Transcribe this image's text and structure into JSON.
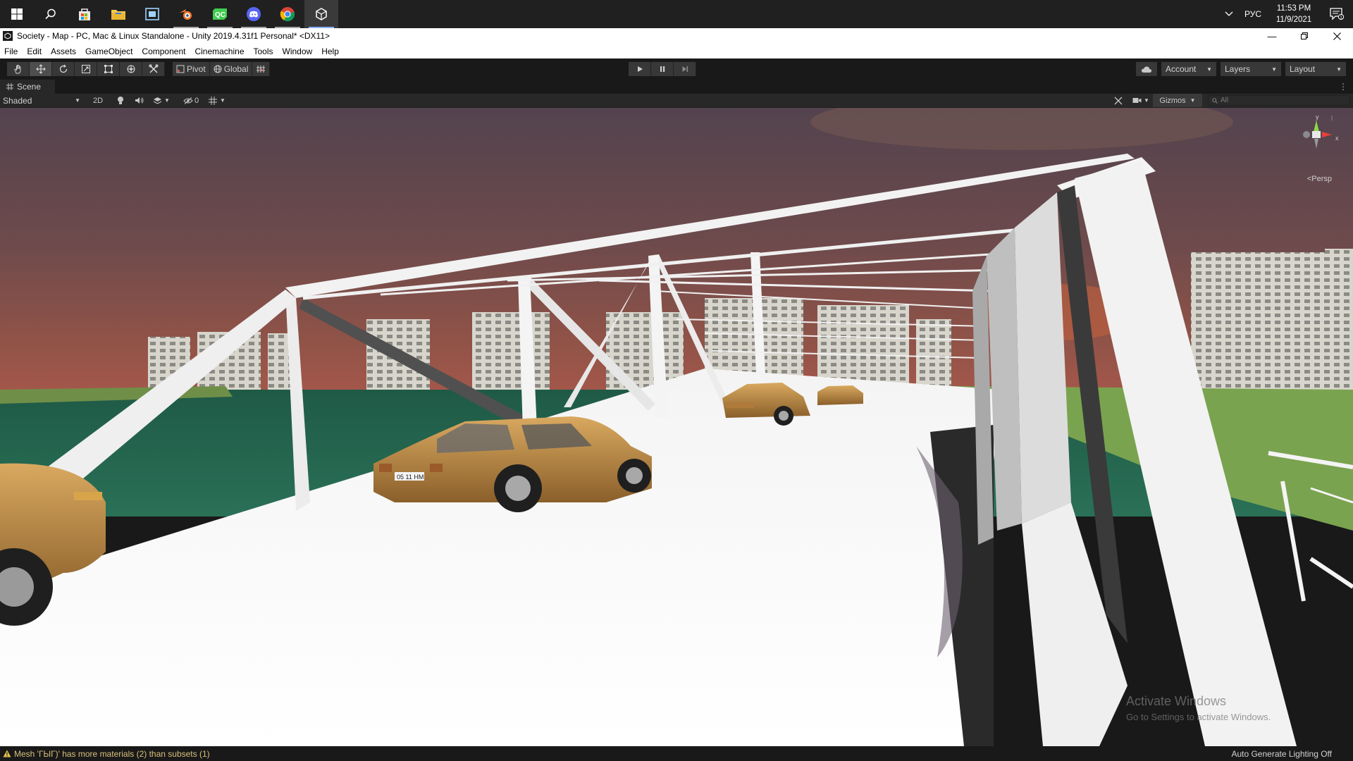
{
  "taskbar": {
    "apps": [
      {
        "name": "windows-start"
      },
      {
        "name": "search"
      },
      {
        "name": "microsoft-store"
      },
      {
        "name": "file-explorer"
      },
      {
        "name": "media-app"
      },
      {
        "name": "blender"
      },
      {
        "name": "qt-creator",
        "label": "QC"
      },
      {
        "name": "discord"
      },
      {
        "name": "chrome"
      },
      {
        "name": "unity"
      }
    ],
    "language": "РУС",
    "time": "11:53 PM",
    "date": "11/9/2021",
    "notification_count": "1"
  },
  "window": {
    "title": "Society - Map - PC, Mac & Linux Standalone - Unity 2019.4.31f1 Personal* <DX11>"
  },
  "menu": {
    "items": [
      "File",
      "Edit",
      "Assets",
      "GameObject",
      "Component",
      "Cinemachine",
      "Tools",
      "Window",
      "Help"
    ]
  },
  "toolbar": {
    "pivot_label": "Pivot",
    "global_label": "Global",
    "account_label": "Account",
    "layers_label": "Layers",
    "layout_label": "Layout"
  },
  "scene": {
    "tab_label": "Scene",
    "shading_mode": "Shaded",
    "mode_2d": "2D",
    "hidden_count": "0",
    "gizmos_label": "Gizmos",
    "search_placeholder": "All",
    "projection_label": "Persp",
    "axis_y": "y",
    "axis_x": "x",
    "plates": {
      "car_front": "05 11 HM"
    }
  },
  "watermark": {
    "title": "Activate Windows",
    "subtitle": "Go to Settings to activate Windows."
  },
  "status": {
    "warning": "Mesh 'ГЫГ)' has more materials (2) than subsets (1)",
    "lighting": "Auto Generate Lighting Off"
  },
  "colors": {
    "accent": "#8ab4f8",
    "warning": "#e6c04a",
    "editor_dark": "#191919",
    "panel": "#282828"
  }
}
